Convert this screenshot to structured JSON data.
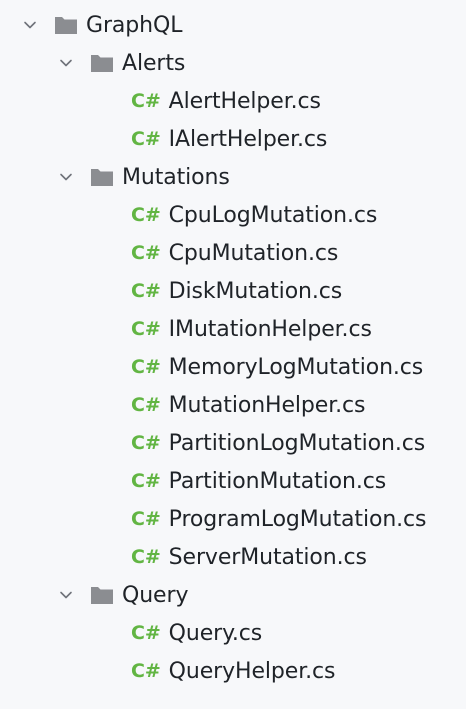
{
  "tree": {
    "root": {
      "label": "GraphQL",
      "icon": "folder-icon",
      "expanded": true
    },
    "folders": [
      {
        "label": "Alerts",
        "icon": "folder-icon",
        "expanded": true,
        "files": [
          "AlertHelper.cs",
          "IAlertHelper.cs"
        ]
      },
      {
        "label": "Mutations",
        "icon": "folder-icon",
        "expanded": true,
        "files": [
          "CpuLogMutation.cs",
          "CpuMutation.cs",
          "DiskMutation.cs",
          "IMutationHelper.cs",
          "MemoryLogMutation.cs",
          "MutationHelper.cs",
          "PartitionLogMutation.cs",
          "PartitionMutation.cs",
          "ProgramLogMutation.cs",
          "ServerMutation.cs"
        ]
      },
      {
        "label": "Query",
        "icon": "folder-icon",
        "expanded": true,
        "files": [
          "Query.cs",
          "QueryHelper.cs"
        ]
      }
    ],
    "file_badge": "C#",
    "colors": {
      "background": "#f7f8fa",
      "text": "#1f2328",
      "csharp_badge": "#62b543",
      "folder": "#8b8d91",
      "chevron": "#6f737a"
    }
  }
}
